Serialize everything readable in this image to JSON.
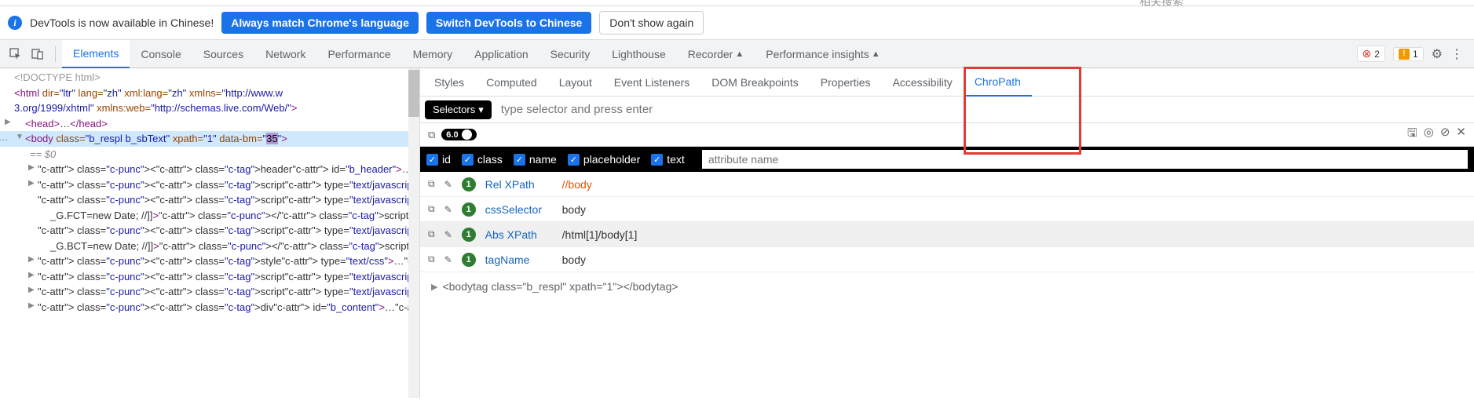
{
  "topcut_hint": "相关搜索",
  "infobar": {
    "text": "DevTools is now available in Chinese!",
    "btn_match": "Always match Chrome's language",
    "btn_switch": "Switch DevTools to Chinese",
    "btn_dismiss": "Don't show again"
  },
  "tabs": [
    "Elements",
    "Console",
    "Sources",
    "Network",
    "Performance",
    "Memory",
    "Application",
    "Security",
    "Lighthouse",
    "Recorder",
    "Performance insights"
  ],
  "active_tab": "Elements",
  "errors": {
    "error_count": "2",
    "warn_count": "1"
  },
  "dom": {
    "doctype": "<!DOCTYPE html>",
    "html_open": {
      "pre": "<html ",
      "attrs": "dir=\"ltr\" lang=\"zh\" xml:lang=\"zh\" xmlns=\"http://www.w",
      "attrs2": "3.org/1999/xhtml\" xmlns:web=\"http://schemas.live.com/Web/\"",
      "close": ">"
    },
    "head": "<head>…</head>",
    "body_open": {
      "pre": "<body ",
      "a1n": "class=",
      "a1v": "\"b_respl b_sbText\"",
      "a2n": " xpath=",
      "a2v": "\"1\"",
      "a3n": " data-bm=",
      "a3v_open": "\"",
      "a3v_hl": "35",
      "a3v_close": "\"",
      "close": ">"
    },
    "eq0": "== $0",
    "children": [
      "<header id=\"b_header\">…</header>",
      "<script type=\"text/javascript\" nonce>…</script​>",
      "<script type=\"text/javascript\" nonce>//<![CDATA[",
      "_G.FCT=new Date; //]]></script​>",
      "<script type=\"text/javascript\" nonce>//<![CDATA[",
      "_G.BCT=new Date; //]]></script​>",
      "<style type=\"text/css\">…</style>",
      "<script type=\"text/javascript\" nonce>…</script​>",
      "<script type=\"text/javascript\" nonce>…</script​>",
      "<div id=\"b_content\">…</div>"
    ]
  },
  "subtabs": [
    "Styles",
    "Computed",
    "Layout",
    "Event Listeners",
    "DOM Breakpoints",
    "Properties",
    "Accessibility",
    "ChroPath"
  ],
  "active_subtab": "ChroPath",
  "chropath": {
    "selector_label": "Selectors",
    "selector_placeholder": "type selector and press enter",
    "version": "6.0",
    "checks": [
      "id",
      "class",
      "name",
      "placeholder",
      "text"
    ],
    "attr_placeholder": "attribute name",
    "results": [
      {
        "label": "Rel XPath",
        "value": "//body",
        "orange": true,
        "count": "1"
      },
      {
        "label": "cssSelector",
        "value": "body",
        "count": "1"
      },
      {
        "label": "Abs XPath",
        "value": "/html[1]/body[1]",
        "count": "1",
        "hl": true
      },
      {
        "label": "tagName",
        "value": "body",
        "count": "1"
      }
    ],
    "tree": "<bodytag class=\"b_respl\" xpath=\"1\"></bodytag>"
  }
}
